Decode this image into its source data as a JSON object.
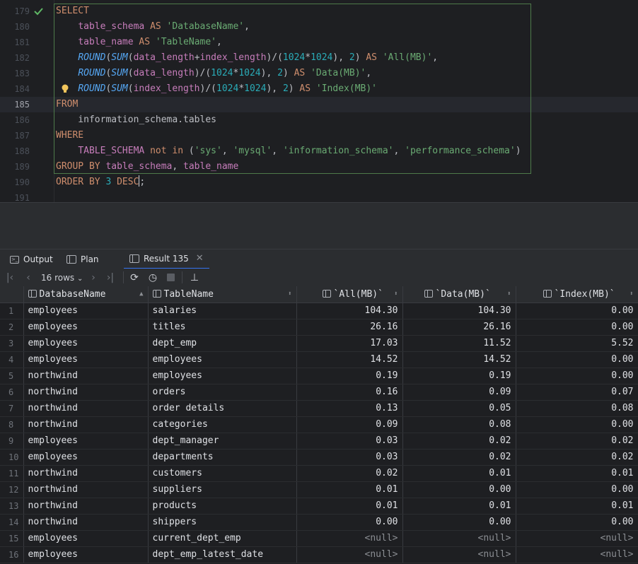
{
  "editor": {
    "lines": [
      {
        "num": "179",
        "tokens": [
          [
            "kw",
            "SELECT"
          ]
        ]
      },
      {
        "num": "180",
        "tokens": [
          [
            "pl",
            "    "
          ],
          [
            "id",
            "table_schema"
          ],
          [
            "pl",
            " "
          ],
          [
            "kw",
            "AS"
          ],
          [
            "pl",
            " "
          ],
          [
            "str",
            "'DatabaseName'"
          ],
          [
            "pl",
            ","
          ]
        ]
      },
      {
        "num": "181",
        "tokens": [
          [
            "pl",
            "    "
          ],
          [
            "id",
            "table_name"
          ],
          [
            "pl",
            " "
          ],
          [
            "kw",
            "AS"
          ],
          [
            "pl",
            " "
          ],
          [
            "str",
            "'TableName'"
          ],
          [
            "pl",
            ","
          ]
        ]
      },
      {
        "num": "182",
        "tokens": [
          [
            "pl",
            "    "
          ],
          [
            "fn",
            "ROUND"
          ],
          [
            "pl",
            "("
          ],
          [
            "fn",
            "SUM"
          ],
          [
            "pl",
            "("
          ],
          [
            "id",
            "data_length"
          ],
          [
            "pl",
            "+"
          ],
          [
            "id",
            "index_length"
          ],
          [
            "pl",
            ")/("
          ],
          [
            "num",
            "1024"
          ],
          [
            "pl",
            "*"
          ],
          [
            "num",
            "1024"
          ],
          [
            "pl",
            "), "
          ],
          [
            "num",
            "2"
          ],
          [
            "pl",
            ") "
          ],
          [
            "kw",
            "AS"
          ],
          [
            "pl",
            " "
          ],
          [
            "str",
            "'All(MB)'"
          ],
          [
            "pl",
            ","
          ]
        ]
      },
      {
        "num": "183",
        "tokens": [
          [
            "pl",
            "    "
          ],
          [
            "fn",
            "ROUND"
          ],
          [
            "pl",
            "("
          ],
          [
            "fn",
            "SUM"
          ],
          [
            "pl",
            "("
          ],
          [
            "id",
            "data_length"
          ],
          [
            "pl",
            ")/("
          ],
          [
            "num",
            "1024"
          ],
          [
            "pl",
            "*"
          ],
          [
            "num",
            "1024"
          ],
          [
            "pl",
            "), "
          ],
          [
            "num",
            "2"
          ],
          [
            "pl",
            ") "
          ],
          [
            "kw",
            "AS"
          ],
          [
            "pl",
            " "
          ],
          [
            "str",
            "'Data(MB)'"
          ],
          [
            "pl",
            ","
          ]
        ]
      },
      {
        "num": "184",
        "tokens": [
          [
            "pl",
            "    "
          ],
          [
            "fn",
            "ROUND"
          ],
          [
            "pl",
            "("
          ],
          [
            "fn",
            "SUM"
          ],
          [
            "pl",
            "("
          ],
          [
            "id",
            "index_length"
          ],
          [
            "pl",
            ")/("
          ],
          [
            "num",
            "1024"
          ],
          [
            "pl",
            "*"
          ],
          [
            "num",
            "1024"
          ],
          [
            "pl",
            "), "
          ],
          [
            "num",
            "2"
          ],
          [
            "pl",
            ") "
          ],
          [
            "kw",
            "AS"
          ],
          [
            "pl",
            " "
          ],
          [
            "str",
            "'Index(MB)'"
          ]
        ]
      },
      {
        "num": "185",
        "tokens": [
          [
            "kw",
            "FROM"
          ]
        ]
      },
      {
        "num": "186",
        "tokens": [
          [
            "pl",
            "    information_schema.tables"
          ]
        ]
      },
      {
        "num": "187",
        "tokens": [
          [
            "kw",
            "WHERE"
          ]
        ]
      },
      {
        "num": "188",
        "tokens": [
          [
            "pl",
            "    "
          ],
          [
            "id",
            "TABLE_SCHEMA"
          ],
          [
            "pl",
            " "
          ],
          [
            "kw",
            "not in"
          ],
          [
            "pl",
            " ("
          ],
          [
            "str",
            "'sys'"
          ],
          [
            "pl",
            ", "
          ],
          [
            "str",
            "'mysql'"
          ],
          [
            "pl",
            ", "
          ],
          [
            "str",
            "'information_schema'"
          ],
          [
            "pl",
            ", "
          ],
          [
            "str",
            "'performance_schema'"
          ],
          [
            "pl",
            ")"
          ]
        ]
      },
      {
        "num": "189",
        "tokens": [
          [
            "kw",
            "GROUP BY"
          ],
          [
            "pl",
            " "
          ],
          [
            "id",
            "table_schema"
          ],
          [
            "pl",
            ", "
          ],
          [
            "id",
            "table_name"
          ]
        ]
      },
      {
        "num": "190",
        "tokens": [
          [
            "kw",
            "ORDER BY"
          ],
          [
            "pl",
            " "
          ],
          [
            "num",
            "3"
          ],
          [
            "pl",
            " "
          ],
          [
            "kw",
            "DESC"
          ],
          [
            "pl",
            ";"
          ]
        ]
      },
      {
        "num": "191",
        "tokens": []
      }
    ]
  },
  "tool_window": {
    "tabs": [
      {
        "label": "Output",
        "active": false
      },
      {
        "label": "Plan",
        "active": false
      },
      {
        "label": "Result 135",
        "active": true
      }
    ],
    "toolbar": {
      "rows_label": "16 rows"
    }
  },
  "grid": {
    "columns": [
      "DatabaseName",
      "TableName",
      "`All(MB)`",
      "`Data(MB)`",
      "`Index(MB)`"
    ],
    "rows": [
      [
        "1",
        "employees",
        "salaries",
        "104.30",
        "104.30",
        "0.00"
      ],
      [
        "2",
        "employees",
        "titles",
        "26.16",
        "26.16",
        "0.00"
      ],
      [
        "3",
        "employees",
        "dept_emp",
        "17.03",
        "11.52",
        "5.52"
      ],
      [
        "4",
        "employees",
        "employees",
        "14.52",
        "14.52",
        "0.00"
      ],
      [
        "5",
        "northwind",
        "employees",
        "0.19",
        "0.19",
        "0.00"
      ],
      [
        "6",
        "northwind",
        "orders",
        "0.16",
        "0.09",
        "0.07"
      ],
      [
        "7",
        "northwind",
        "order details",
        "0.13",
        "0.05",
        "0.08"
      ],
      [
        "8",
        "northwind",
        "categories",
        "0.09",
        "0.08",
        "0.00"
      ],
      [
        "9",
        "employees",
        "dept_manager",
        "0.03",
        "0.02",
        "0.02"
      ],
      [
        "10",
        "employees",
        "departments",
        "0.03",
        "0.02",
        "0.02"
      ],
      [
        "11",
        "northwind",
        "customers",
        "0.02",
        "0.01",
        "0.01"
      ],
      [
        "12",
        "northwind",
        "suppliers",
        "0.01",
        "0.00",
        "0.00"
      ],
      [
        "13",
        "northwind",
        "products",
        "0.01",
        "0.01",
        "0.01"
      ],
      [
        "14",
        "northwind",
        "shippers",
        "0.00",
        "0.00",
        "0.00"
      ],
      [
        "15",
        "employees",
        "current_dept_emp",
        "<null>",
        "<null>",
        "<null>"
      ],
      [
        "16",
        "employees",
        "dept_emp_latest_date",
        "<null>",
        "<null>",
        "<null>"
      ]
    ]
  }
}
